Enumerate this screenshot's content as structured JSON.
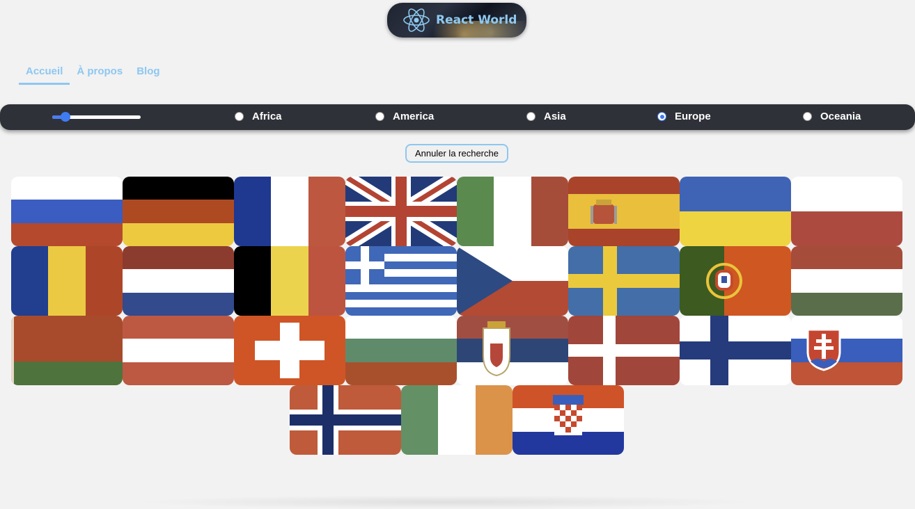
{
  "header": {
    "logo_text": "React World"
  },
  "nav": [
    {
      "label": "Accueil",
      "active": true
    },
    {
      "label": "À propos",
      "active": false
    },
    {
      "label": "Blog",
      "active": false
    }
  ],
  "filter": {
    "range_value_fraction": 0.15,
    "regions": [
      {
        "label": "Africa",
        "checked": false
      },
      {
        "label": "America",
        "checked": false
      },
      {
        "label": "Asia",
        "checked": false
      },
      {
        "label": "Europe",
        "checked": true
      },
      {
        "label": "Oceania",
        "checked": false
      }
    ]
  },
  "cancel_button": "Annuler la recherche",
  "flags": [
    "russia-flag",
    "germany-flag",
    "france-flag",
    "united-kingdom-flag",
    "italy-flag",
    "spain-flag",
    "ukraine-flag",
    "poland-flag",
    "romania-flag",
    "netherlands-flag",
    "belgium-flag",
    "greece-flag",
    "czechia-flag",
    "sweden-flag",
    "portugal-flag",
    "hungary-flag",
    "belarus-flag",
    "austria-flag",
    "switzerland-flag",
    "bulgaria-flag",
    "serbia-flag",
    "denmark-flag",
    "finland-flag",
    "slovakia-flag",
    "norway-flag",
    "ireland-flag",
    "croatia-flag"
  ]
}
